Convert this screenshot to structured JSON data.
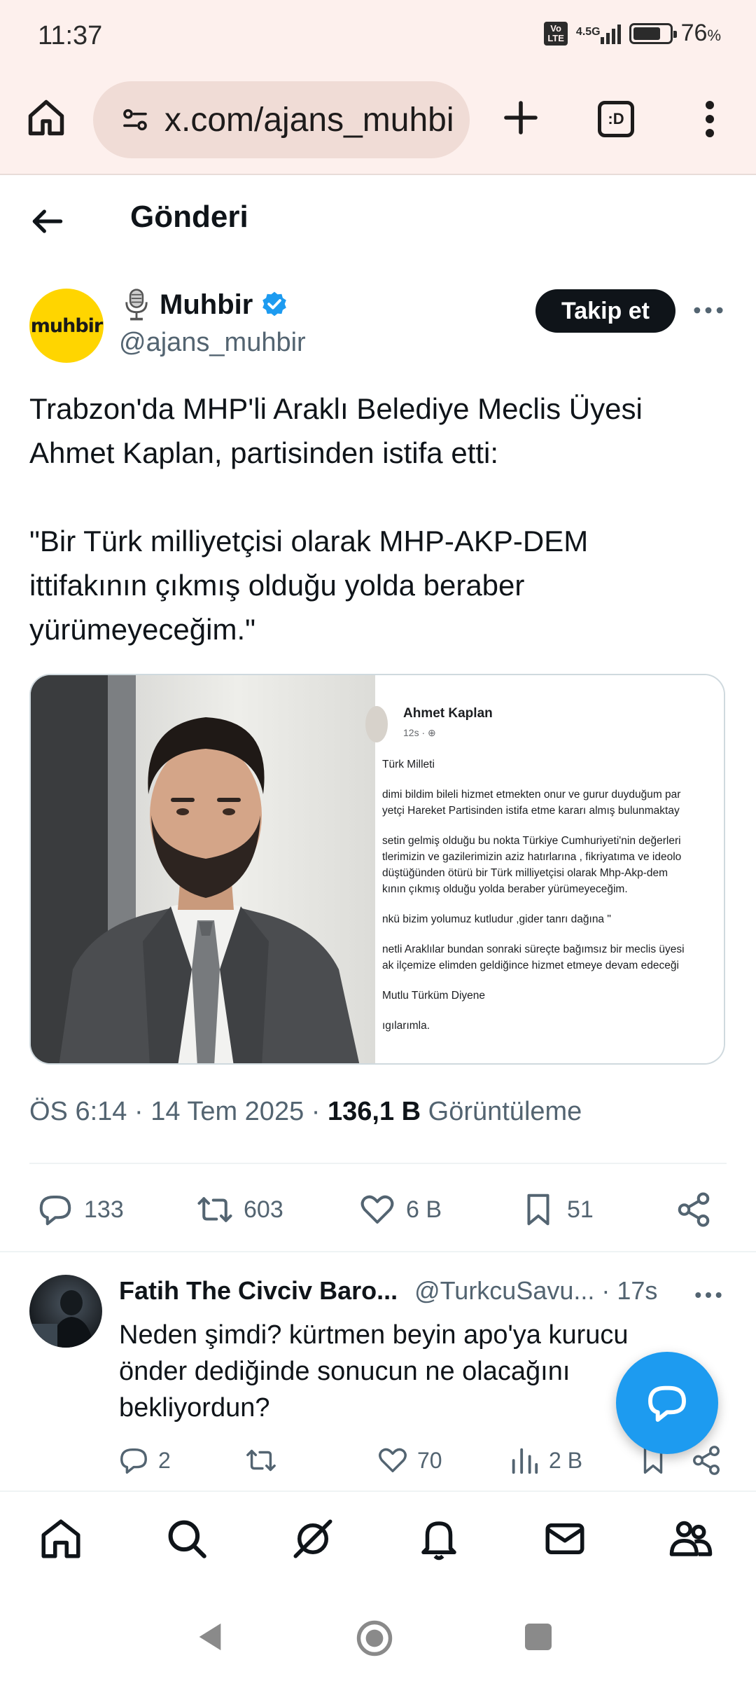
{
  "status_bar": {
    "time": "11:37",
    "volte_label": "Vo\nLTE",
    "network": "4.5G",
    "battery_percent": "76",
    "battery_unit": "%",
    "battery_level": 0.76
  },
  "browser": {
    "url": "x.com/ajans_muhbi",
    "tabs_label": ":D"
  },
  "header": {
    "title": "Gönderi"
  },
  "tweet": {
    "avatar_text": "muhbir",
    "author_name": "Muhbir",
    "handle": "@ajans_muhbir",
    "follow_label": "Takip et",
    "text_lines": [
      "Trabzon'da MHP'li Araklı Belediye Meclis Üyesi",
      "Ahmet Kaplan, partisinden istifa etti:",
      "",
      "\"Bir Türk milliyetçisi olarak MHP-AKP-DEM",
      "ittifakının çıkmış olduğu yolda beraber",
      "yürümeyeceğim.\""
    ],
    "embedded_post": {
      "name": "Ahmet Kaplan",
      "time": "12s · ",
      "lines": [
        "Türk Milleti",
        "",
        "dimi bildim bileli hizmet etmekten onur ve gurur duyduğum par",
        "yetçi Hareket Partisinden istifa etme kararı almış bulunmaktay",
        "",
        "setin gelmiş olduğu bu nokta Türkiye Cumhuriyeti'nin değerleri",
        "tlerimizin ve gazilerimizin aziz hatırlarına , fikriyatıma ve ideolo",
        "düştüğünden ötürü bir Türk milliyetçisi olarak Mhp-Akp-dem",
        "kının çıkmış olduğu yolda beraber yürümeyeceğim.",
        "",
        "nkü bizim yolumuz kutludur ,gider tanrı dağına \"",
        "",
        "netli Araklılar bundan sonraki süreçte bağımsız bir meclis üyesi",
        "ak ilçemize elimden geldiğince hizmet etmeye devam edeceği",
        "",
        "Mutlu Türküm Diyene",
        "",
        "ıgılarımla."
      ]
    },
    "timestamp": "ÖS 6:14 · 14 Tem 2025 · ",
    "views_count": "136,1 B",
    "views_label": " Görüntüleme",
    "stats": {
      "replies": "133",
      "reposts": "603",
      "likes": "6 B",
      "bookmarks": "51"
    }
  },
  "reply": {
    "name": "Fatih The Civciv Baro...",
    "handle_time": "@TurkcuSavu... · 17s",
    "text": "Neden şimdi? kürtmen beyin apo'ya kurucu önder dediğinde sonucun ne olacağını bekliyordun?",
    "stats": {
      "replies": "2",
      "likes": "70",
      "views": "2 B"
    }
  },
  "colors": {
    "brand_blue": "#1d9bf0",
    "avatar_yellow": "#ffd500",
    "chrome_bg": "#fdf0ed",
    "secondary_text": "#536471"
  }
}
